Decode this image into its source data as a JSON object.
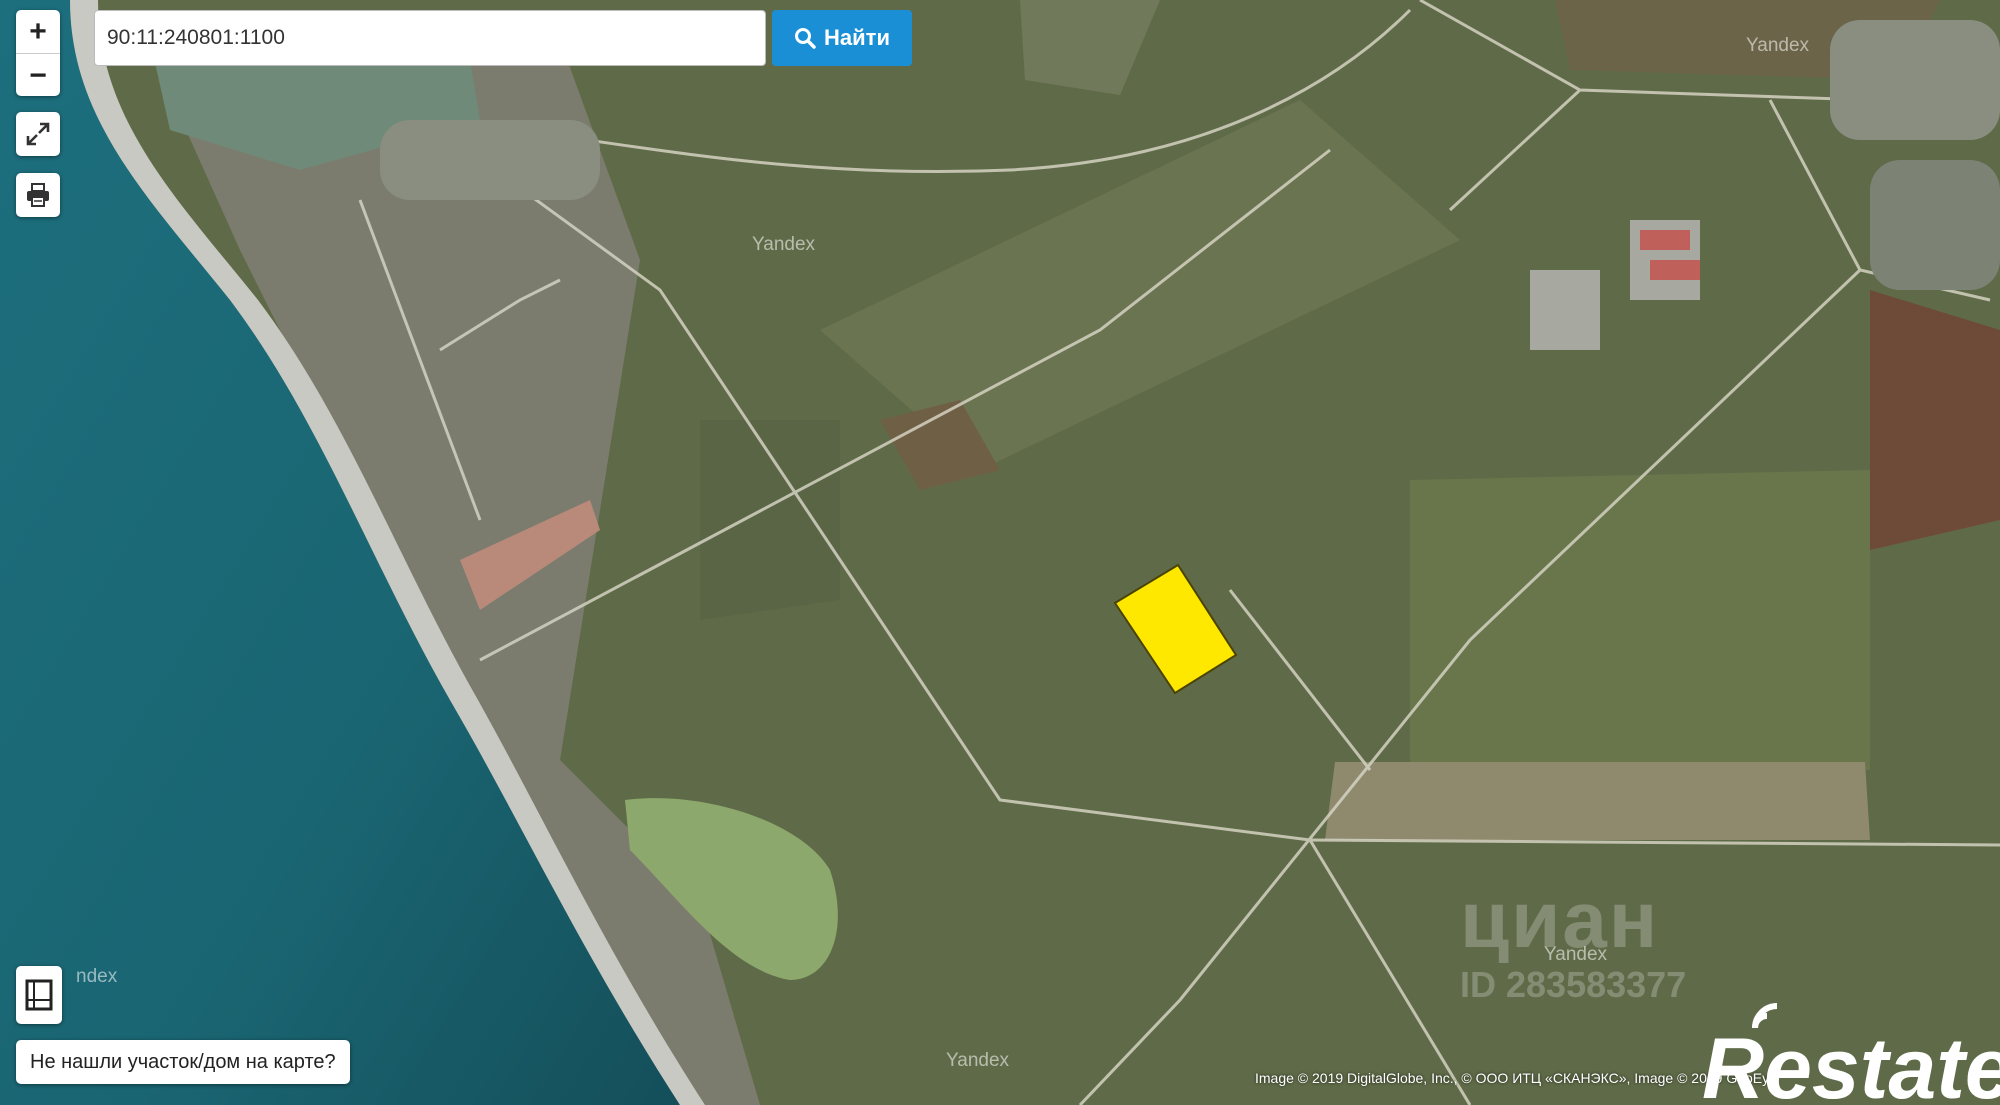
{
  "search": {
    "value": "90:11:240801:1100",
    "button_label": "Найти"
  },
  "controls": {
    "zoom_in": "+",
    "zoom_out": "−"
  },
  "not_found_label": "Не нашли участок/дом на карте?",
  "map_labels": [
    "Yandex",
    "Yandex",
    "Yandex",
    "Yandex",
    "Yandex"
  ],
  "partial_label": "ndex",
  "attribution": "Image © 2019 DigitalGlobe, Inc., © ООО ИТЦ «СКАНЭКС», Image © 2019 GeoEye",
  "watermark": {
    "brand": "циан",
    "id": "ID 283583377",
    "logo_text": "Restate"
  },
  "colors": {
    "sea": "#1f6e7a",
    "land": "#5f6b48",
    "parcel": "#ffe800",
    "search_button": "#1a8fd6"
  }
}
